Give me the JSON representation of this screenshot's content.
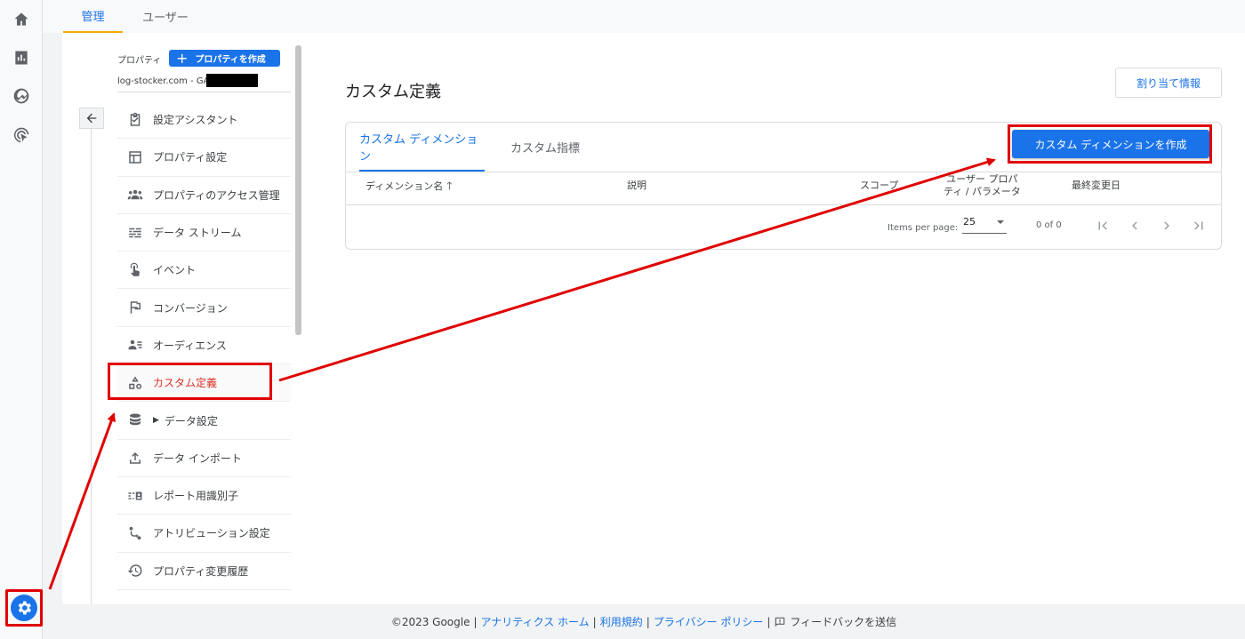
{
  "top_tabs": {
    "admin": "管理",
    "user": "ユーザー"
  },
  "property": {
    "label": "プロパティ",
    "create_button": "プロパティを作成",
    "name": "log-stocker.com - GA4"
  },
  "nav": {
    "items": [
      {
        "label": "設定アシスタント",
        "icon": "checklist-icon"
      },
      {
        "label": "プロパティ設定",
        "icon": "layout-icon"
      },
      {
        "label": "プロパティのアクセス管理",
        "icon": "people-icon"
      },
      {
        "label": "データ ストリーム",
        "icon": "streams-icon"
      },
      {
        "label": "イベント",
        "icon": "touch-icon"
      },
      {
        "label": "コンバージョン",
        "icon": "flag-icon"
      },
      {
        "label": "オーディエンス",
        "icon": "audience-icon"
      },
      {
        "label": "カスタム定義",
        "icon": "shapes-icon"
      },
      {
        "label": "データ設定",
        "icon": "database-icon"
      },
      {
        "label": "データ インポート",
        "icon": "upload-icon"
      },
      {
        "label": "レポート用識別子",
        "icon": "identity-icon"
      },
      {
        "label": "アトリビューション設定",
        "icon": "attribution-icon"
      },
      {
        "label": "プロパティ変更履歴",
        "icon": "history-icon"
      }
    ]
  },
  "main": {
    "title": "カスタム定義",
    "assign_button": "割り当て情報",
    "tabs": {
      "dimensions": "カスタム ディメンション",
      "metrics": "カスタム指標"
    },
    "create_button": "カスタム ディメンションを作成",
    "columns": {
      "name": "ディメンション名",
      "description": "説明",
      "scope": "スコープ",
      "user_prop_line1": "ユーザー プロパ",
      "user_prop_line2": "ティ / パラメータ",
      "last_modified": "最終変更日"
    },
    "pager": {
      "items_per_page": "Items per page:",
      "per_page_value": "25",
      "range": "0 of 0"
    }
  },
  "footer": {
    "copyright": "©2023 Google",
    "sep": "|",
    "analytics_home": "アナリティクス ホーム",
    "terms": "利用規約",
    "privacy": "プライバシー ポリシー",
    "feedback": "フィードバックを送信"
  },
  "colors": {
    "accent": "#1a73e8",
    "annotation": "#e00000",
    "warning_tab": "#f9ab00"
  }
}
